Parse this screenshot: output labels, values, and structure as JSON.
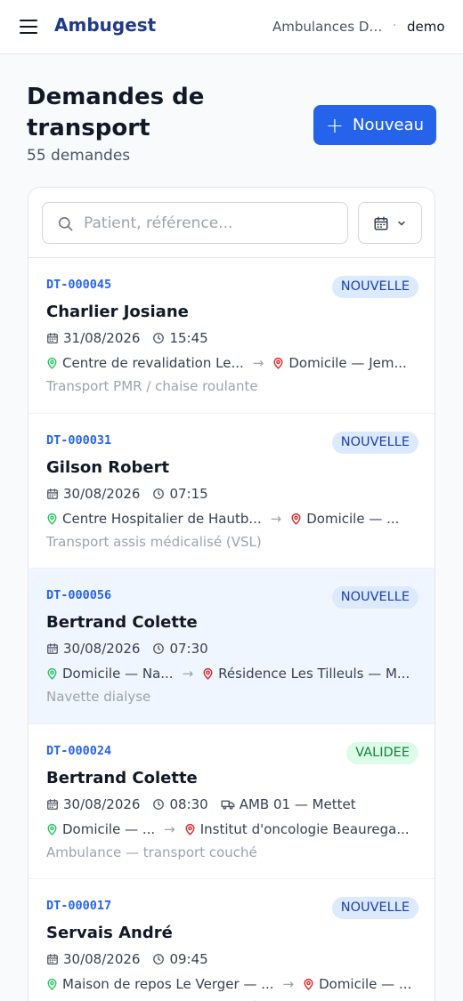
{
  "header": {
    "brand": "Ambugest",
    "org": "Ambulances Dupont Mettet",
    "separator": "·",
    "user": "demo"
  },
  "page": {
    "title": "Demandes de transport",
    "count": "55 demandes",
    "new_label": "Nouveau",
    "new_plus": "+"
  },
  "search": {
    "placeholder": "Patient, référence..."
  },
  "route_arrow": "→",
  "colors": {
    "brand": "#1e3a8a",
    "primary": "#2563eb",
    "origin": "#22c55e",
    "destination": "#dc2626"
  },
  "requests": [
    {
      "ref": "DT-000045",
      "status": "NOUVELLE",
      "status_kind": "nouvelle",
      "patient": "Charlier Josiane",
      "date": "31/08/2026",
      "time": "15:45",
      "vehicle": "",
      "origin": "Centre de revalidation Le...",
      "destination": "Domicile — Jem...",
      "transport": "Transport PMR / chaise roulante"
    },
    {
      "ref": "DT-000031",
      "status": "NOUVELLE",
      "status_kind": "nouvelle",
      "patient": "Gilson Robert",
      "date": "30/08/2026",
      "time": "07:15",
      "vehicle": "",
      "origin": "Centre Hospitalier de Hautb...",
      "destination": "Domicile — ...",
      "transport": "Transport assis médicalisé (VSL)"
    },
    {
      "ref": "DT-000056",
      "status": "NOUVELLE",
      "status_kind": "nouvelle",
      "patient": "Bertrand Colette",
      "date": "30/08/2026",
      "time": "07:30",
      "vehicle": "",
      "origin": "Domicile — Na...",
      "destination": "Résidence Les Tilleuls — M...",
      "transport": "Navette dialyse"
    },
    {
      "ref": "DT-000024",
      "status": "VALIDEE",
      "status_kind": "validee",
      "patient": "Bertrand Colette",
      "date": "30/08/2026",
      "time": "08:30",
      "vehicle": "AMB 01 — Mettet",
      "origin": "Domicile — ...",
      "destination": "Institut d'oncologie Beaurega...",
      "transport": "Ambulance — transport couché"
    },
    {
      "ref": "DT-000017",
      "status": "NOUVELLE",
      "status_kind": "nouvelle",
      "patient": "Servais André",
      "date": "30/08/2026",
      "time": "09:45",
      "vehicle": "",
      "origin": "Maison de repos Le Verger — ...",
      "destination": "Domicile — ...",
      "transport": "Ambulance — transport couché"
    }
  ]
}
